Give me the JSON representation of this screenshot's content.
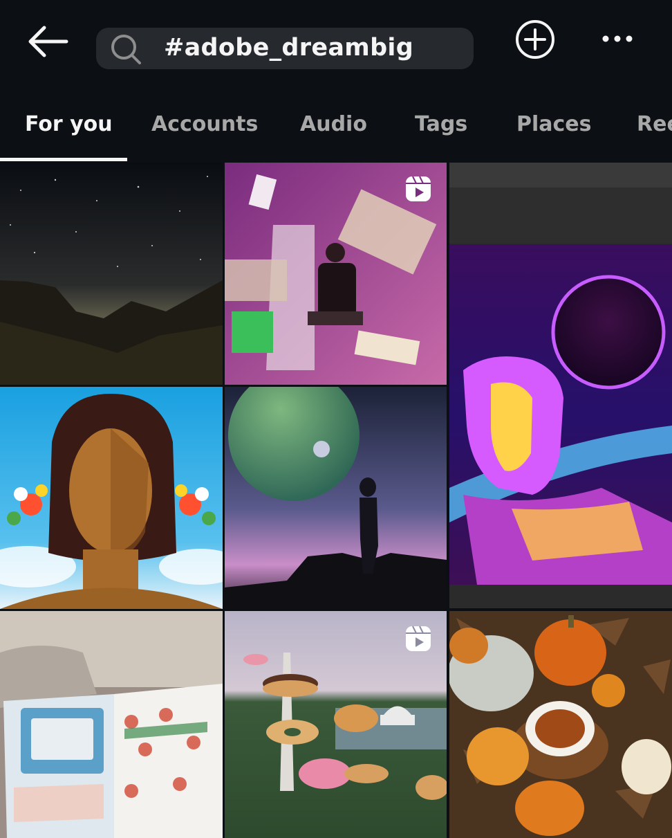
{
  "header": {
    "search_query": "#adobe_dreambig",
    "back_icon": "arrow-left-icon",
    "search_icon": "search-icon",
    "add_icon": "plus-circle-icon",
    "more_icon": "more-horizontal-icon"
  },
  "tabs": [
    {
      "label": "For you",
      "active": true
    },
    {
      "label": "Accounts",
      "active": false
    },
    {
      "label": "Audio",
      "active": false
    },
    {
      "label": "Tags",
      "active": false
    },
    {
      "label": "Places",
      "active": false
    },
    {
      "label": "Reels",
      "active": false
    }
  ],
  "grid": {
    "posts": [
      {
        "subject": "starry night over mountains",
        "reel": false
      },
      {
        "subject": "man seated on stairs with flying money",
        "reel": true
      },
      {
        "subject": "neon statue bust with planet",
        "reel": false
      },
      {
        "subject": "illustrated woman portrait with flowers",
        "reel": false
      },
      {
        "subject": "silhouette on rock under planet sky",
        "reel": false
      },
      {
        "subject": "airline safety card",
        "reel": false
      },
      {
        "subject": "giant donuts over city monuments",
        "reel": true
      },
      {
        "subject": "pumpkins and tea on leaves",
        "reel": false
      }
    ]
  },
  "colors": {
    "background": "#0c1014",
    "search_field": "#262a2e",
    "text_primary": "#f5f5f5",
    "text_secondary": "#a8a8a8"
  }
}
